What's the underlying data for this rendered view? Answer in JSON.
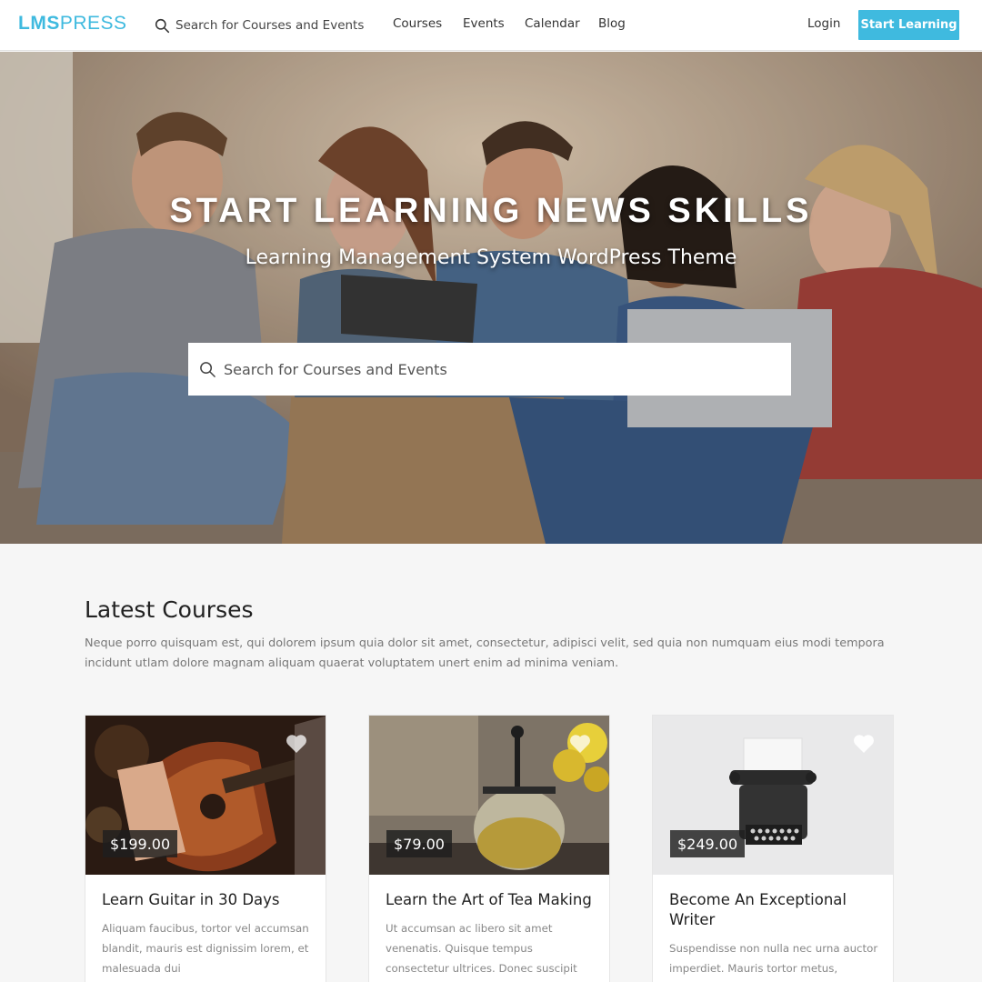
{
  "header": {
    "logo_bold": "LMS",
    "logo_light": "PRESS",
    "search_placeholder": "Search for Courses and Events",
    "nav": [
      "Courses",
      "Events",
      "Calendar",
      "Blog"
    ],
    "login": "Login",
    "cta": "Start Learning"
  },
  "hero": {
    "title": "START LEARNING NEWS SKILLS",
    "subtitle": "Learning Management System WordPress Theme",
    "search_placeholder": "Search for Courses and Events"
  },
  "courses": {
    "title": "Latest Courses",
    "description": "Neque porro quisquam est, qui dolorem ipsum quia dolor sit amet, consectetur, adipisci velit, sed quia non numquam eius modi tempora incidunt utlam dolore magnam aliquam quaerat voluptatem unert enim ad minima veniam.",
    "items": [
      {
        "price": "$199.00",
        "title": "Learn Guitar in 30 Days",
        "desc": "Aliquam faucibus, tortor vel accumsan blandit, mauris est dignissim lorem, et malesuada dui"
      },
      {
        "price": "$79.00",
        "title": "Learn the Art of Tea Making",
        "desc": "Ut accumsan ac libero sit amet venenatis. Quisque tempus consectetur ultrices. Donec suscipit"
      },
      {
        "price": "$249.00",
        "title": "Become An Exceptional Writer",
        "desc": "Suspendisse non nulla nec urna auctor imperdiet. Mauris tortor metus, maximus"
      }
    ]
  },
  "colors": {
    "accent": "#3fbadf"
  },
  "icons": {
    "search": "search-icon",
    "favorite": "heart-icon"
  }
}
